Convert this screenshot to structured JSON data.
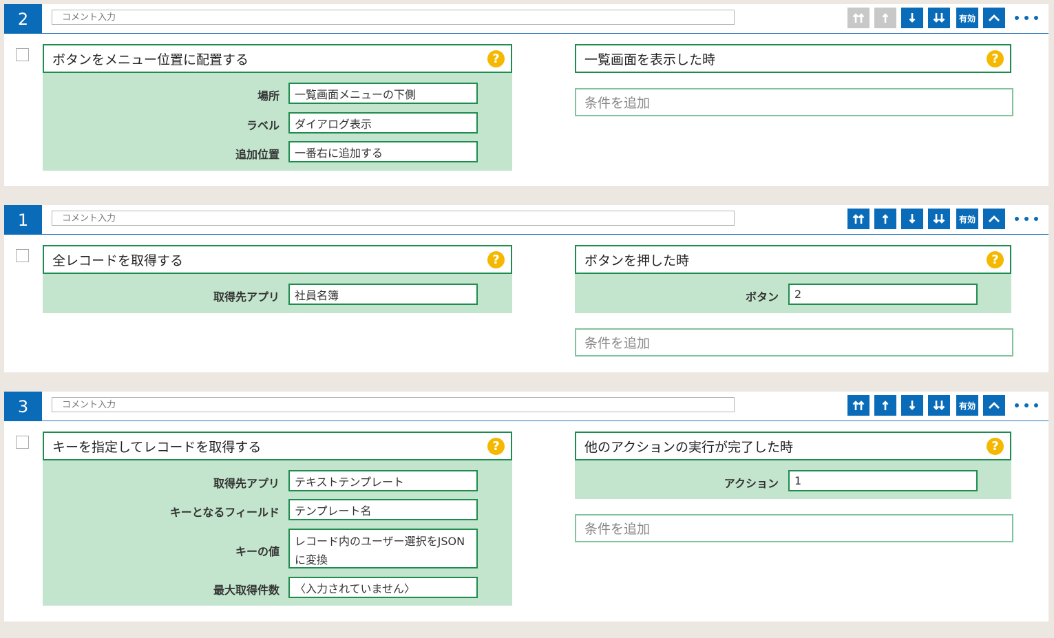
{
  "colors": {
    "primary": "#0a6cb9",
    "disabled": "#c8c8c8",
    "green_border": "#1e8c4e",
    "green_fill": "#c3e5cd",
    "help": "#f5b800",
    "background": "#ede7e2"
  },
  "toolbar_labels": {
    "valid": "有効"
  },
  "help_glyph": "?",
  "cards": [
    {
      "number": "2",
      "comment_placeholder": "コメント入力",
      "action": {
        "title": "ボタンをメニュー位置に配置する",
        "fields": [
          {
            "label": "場所",
            "value": "一覧画面メニューの下側"
          },
          {
            "label": "ラベル",
            "value": "ダイアログ表示"
          },
          {
            "label": "追加位置",
            "value": "一番右に追加する"
          }
        ]
      },
      "trigger": {
        "title": "一覧画面を表示した時"
      },
      "add_condition": "条件を追加"
    },
    {
      "number": "1",
      "comment_placeholder": "コメント入力",
      "action": {
        "title": "全レコードを取得する",
        "fields": [
          {
            "label": "取得先アプリ",
            "value": "社員名簿"
          }
        ]
      },
      "trigger": {
        "title": "ボタンを押した時",
        "fields": [
          {
            "label": "ボタン",
            "value": "2"
          }
        ]
      },
      "add_condition": "条件を追加"
    },
    {
      "number": "3",
      "comment_placeholder": "コメント入力",
      "action": {
        "title": "キーを指定してレコードを取得する",
        "fields": [
          {
            "label": "取得先アプリ",
            "value": "テキストテンプレート"
          },
          {
            "label": "キーとなるフィールド",
            "value": "テンプレート名"
          },
          {
            "label": "キーの値",
            "value": "レコード内のユーザー選択をJSONに変換"
          },
          {
            "label": "最大取得件数",
            "value": "〈入力されていません〉"
          }
        ]
      },
      "trigger": {
        "title": "他のアクションの実行が完了した時",
        "fields": [
          {
            "label": "アクション",
            "value": "1"
          }
        ]
      },
      "add_condition": "条件を追加"
    }
  ]
}
